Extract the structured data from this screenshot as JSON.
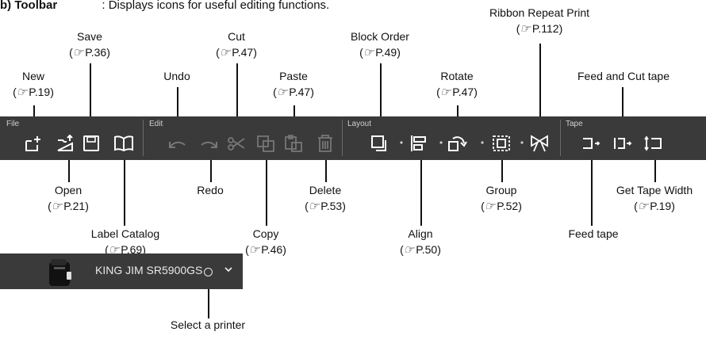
{
  "header": {
    "label": "b) Toolbar",
    "description": ": Displays icons for useful editing functions."
  },
  "ref_prefix": "(",
  "ref_suffix": ")",
  "toolbar": {
    "groups": [
      "File",
      "Edit",
      "Layout",
      "Tape"
    ]
  },
  "callouts": {
    "new": {
      "label": "New",
      "ref": "P.19"
    },
    "save": {
      "label": "Save",
      "ref": "P.36"
    },
    "open": {
      "label": "Open",
      "ref": "P.21"
    },
    "label_catalog": {
      "label": "Label Catalog",
      "ref": "P.69"
    },
    "undo": {
      "label": "Undo"
    },
    "redo": {
      "label": "Redo"
    },
    "cut": {
      "label": "Cut",
      "ref": "P.47"
    },
    "paste": {
      "label": "Paste",
      "ref": "P.47"
    },
    "copy": {
      "label": "Copy",
      "ref": "P.46"
    },
    "delete": {
      "label": "Delete",
      "ref": "P.53"
    },
    "block_order": {
      "label": "Block Order",
      "ref": "P.49"
    },
    "align": {
      "label": "Align",
      "ref": "P.50"
    },
    "rotate": {
      "label": "Rotate",
      "ref": "P.47"
    },
    "group": {
      "label": "Group",
      "ref": "P.52"
    },
    "ribbon_repeat_print": {
      "label": "Ribbon Repeat Print",
      "ref": "P.112"
    },
    "feed_and_cut_tape": {
      "label": "Feed and Cut tape"
    },
    "feed_tape": {
      "label": "Feed tape"
    },
    "get_tape_width": {
      "label": "Get Tape Width",
      "ref": "P.19"
    },
    "select_printer": {
      "label": "Select a printer"
    }
  },
  "printer": {
    "name": "KING JIM SR5900GS"
  }
}
